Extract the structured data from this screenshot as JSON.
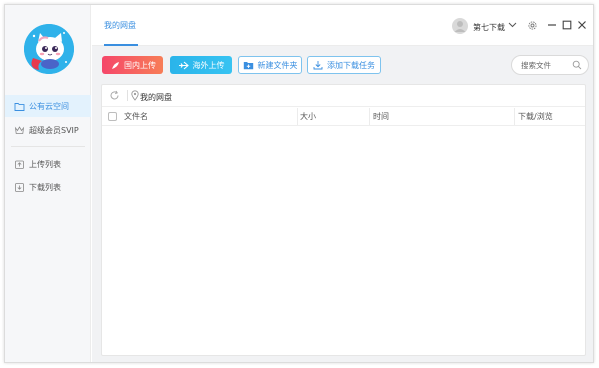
{
  "sidebar": {
    "items": [
      {
        "label": "公有云空间",
        "icon": "folder-icon",
        "active": true
      },
      {
        "label": "超级会员SVIP",
        "icon": "crown-icon",
        "active": false
      },
      {
        "label": "上传列表",
        "icon": "upload-icon",
        "active": false
      },
      {
        "label": "下载列表",
        "icon": "download-icon",
        "active": false
      }
    ]
  },
  "header": {
    "tab": "我的网盘",
    "user_name": "第七下载"
  },
  "toolbar": {
    "domestic_upload": "国内上传",
    "overseas_upload": "海外上传",
    "new_folder": "新建文件夹",
    "add_download": "添加下载任务"
  },
  "search": {
    "placeholder": "搜索文件"
  },
  "breadcrumb": {
    "current": "我的网盘"
  },
  "table": {
    "columns": [
      "文件名",
      "大小",
      "时间",
      "下载/浏览"
    ]
  },
  "colors": {
    "accent": "#3a8fe0",
    "domestic_gradient_start": "#f5476a",
    "overseas_gradient_start": "#2ab4ea"
  }
}
